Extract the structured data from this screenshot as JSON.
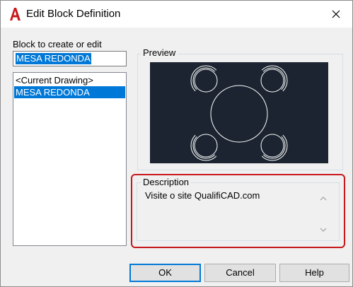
{
  "window": {
    "title": "Edit Block Definition",
    "app_icon": "autocad-a-icon",
    "close_icon": "close-icon",
    "accent_color": "#c8181c"
  },
  "block": {
    "label": "Block to create or edit",
    "name_value": "MESA REDONDA",
    "list": [
      {
        "label": "<Current Drawing>",
        "selected": false
      },
      {
        "label": "MESA REDONDA",
        "selected": true
      }
    ],
    "selection_color": "#0078d7"
  },
  "preview": {
    "label": "Preview",
    "background_color": "#1b2430"
  },
  "description": {
    "label": "Description",
    "text": "Visite o site QualifiCAD.com",
    "highlight_color": "#c8181c"
  },
  "buttons": {
    "ok": "OK",
    "cancel": "Cancel",
    "help": "Help"
  }
}
